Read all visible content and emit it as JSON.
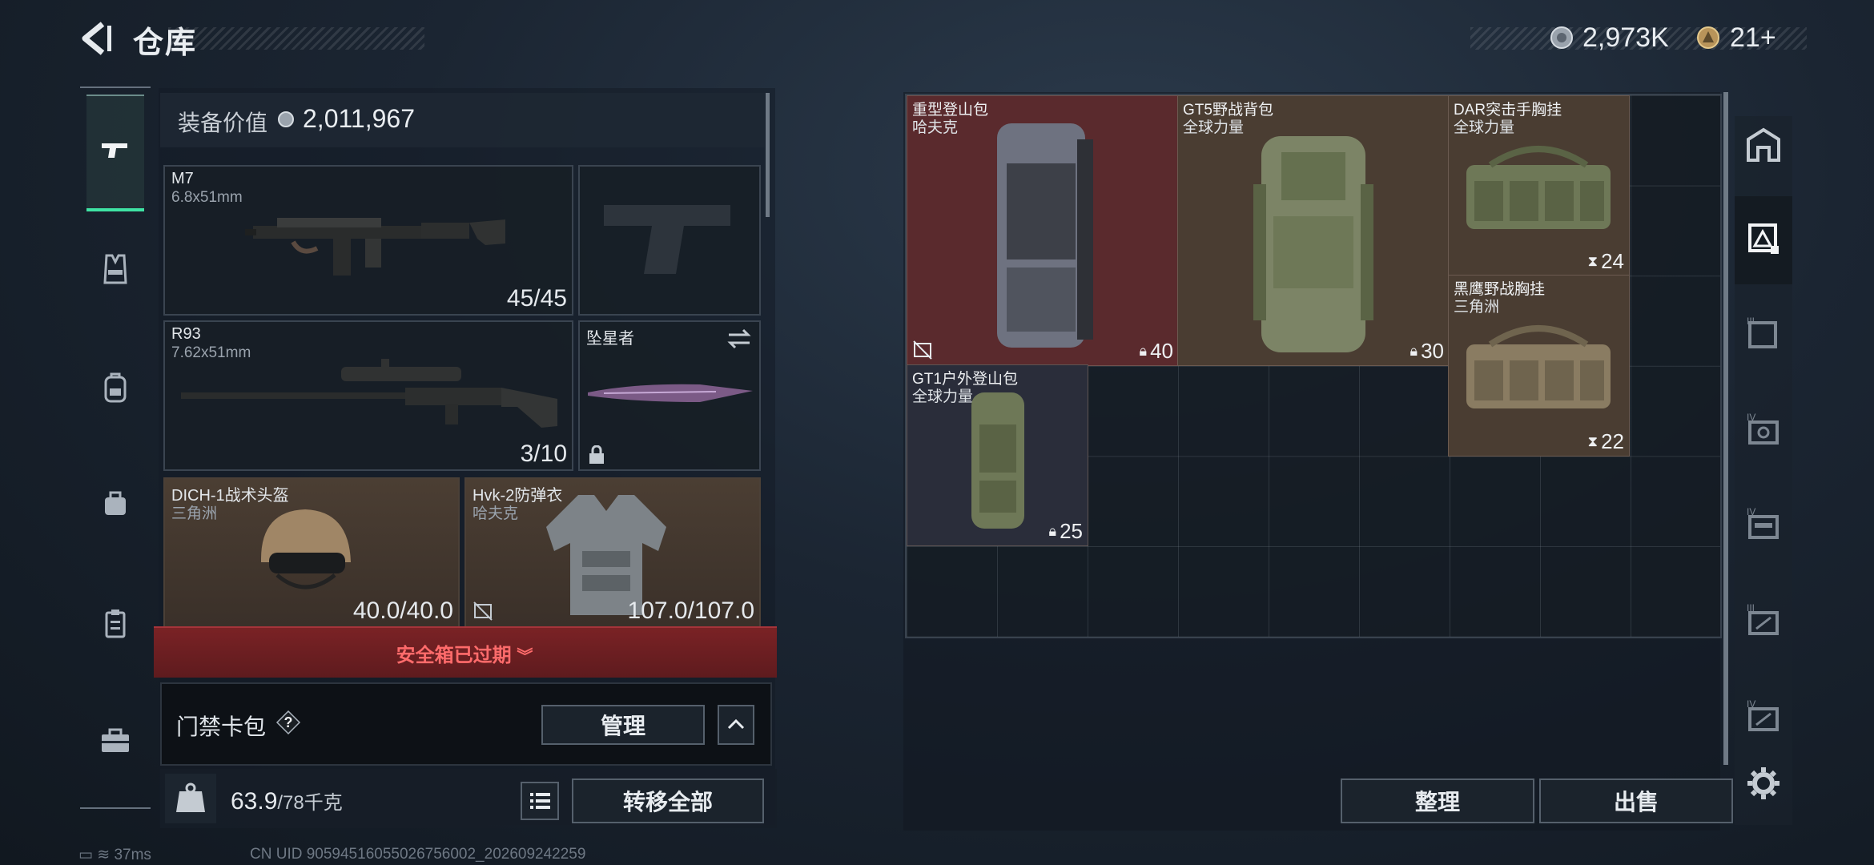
{
  "header": {
    "title": "仓库",
    "currency_primary": "2,973K",
    "currency_secondary": "21+"
  },
  "left_rail": {
    "items": [
      {
        "name": "pistol-icon",
        "active": true
      },
      {
        "name": "vest-icon"
      },
      {
        "name": "backpack-icon"
      },
      {
        "name": "bag-icon"
      },
      {
        "name": "clipboard-icon"
      },
      {
        "name": "toolbox-icon"
      }
    ]
  },
  "loadout": {
    "value_label": "装备价值",
    "value": "2,011,967",
    "slots": {
      "primary": {
        "name": "M7",
        "caliber": "6.8x51mm",
        "ammo": "45/45"
      },
      "pistol": {
        "name": ""
      },
      "secondary": {
        "name": "R93",
        "caliber": "7.62x51mm",
        "ammo": "3/10"
      },
      "melee": {
        "name": "坠星者"
      },
      "helmet": {
        "name": "DICH-1战术头盔",
        "faction": "三角洲",
        "durability": "40.0/40.0"
      },
      "armor": {
        "name": "Hvk-2防弹衣",
        "faction": "哈夫克",
        "durability": "107.0/107.0"
      }
    },
    "safe_box_status": "安全箱已过期",
    "keycard_label": "门禁卡包",
    "keycard_help": "?",
    "manage_label": "管理",
    "weight_current": "63.9",
    "weight_max": "/78千克",
    "transfer_all_label": "转移全部"
  },
  "storage": {
    "items": [
      {
        "name": "重型登山包",
        "brand": "哈夫克",
        "capacity": "40",
        "bg": "#5a2a2d"
      },
      {
        "name": "GT5野战背包",
        "brand": "全球力量",
        "capacity": "30",
        "bg": "#4a3d32"
      },
      {
        "name": "DAR突击手胸挂",
        "brand": "全球力量",
        "capacity": "24",
        "bg": "#4a3d32"
      },
      {
        "name": "黑鹰野战胸挂",
        "brand": "三角洲",
        "capacity": "22",
        "bg": "#4a3d32"
      },
      {
        "name": "GT1户外登山包",
        "brand": "全球力量",
        "capacity": "25",
        "bg": "#2a2d3a"
      }
    ],
    "sort_label": "整理",
    "sell_label": "出售"
  },
  "right_rail": {
    "items": [
      {
        "name": "home-shelf-icon"
      },
      {
        "name": "storage-tier-1-icon",
        "active": true
      },
      {
        "name": "storage-tier-3-icon"
      },
      {
        "name": "storage-tier-4-icon"
      },
      {
        "name": "storage-tier-4b-icon"
      },
      {
        "name": "storage-tier-3b-icon"
      },
      {
        "name": "storage-tier-4c-icon"
      },
      {
        "name": "settings-icon"
      }
    ]
  },
  "status": {
    "ping": "37ms",
    "uid": "CN UID 90594516055026756002_202609242259"
  },
  "colors": {
    "accent_green": "#3fe3a4",
    "alert_red": "#ff6b6b"
  }
}
